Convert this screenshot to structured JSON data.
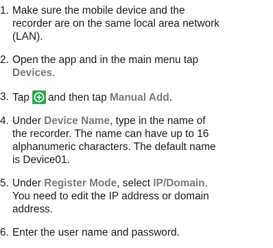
{
  "steps": [
    {
      "number": "1.",
      "lines": [
        "Make sure the mobile device and the",
        "recorder are on the same local area network",
        "(LAN)."
      ]
    },
    {
      "number": "2.",
      "line1": "Open the app and in the main menu tap",
      "highlight": "Devices",
      "suffix": "."
    },
    {
      "number": "3.",
      "before_icon": "Tap",
      "after_icon": "and then tap",
      "highlight": "Manual Add",
      "suffix": ".",
      "icon": "add-device-icon"
    },
    {
      "number": "4.",
      "prefix": "Under",
      "highlight": "Device Name",
      "line1_rest": ", type in the name of",
      "lines": [
        "the recorder. The name can have up to 16",
        "alphanumeric characters. The default name",
        "is Device01."
      ]
    },
    {
      "number": "5.",
      "prefix": "Under",
      "highlight1": "Register Mode",
      "middle": ", select",
      "highlight2": "IP/Domain",
      "suffix": ".",
      "lines": [
        "You need to edit the IP address or domain",
        "address."
      ]
    },
    {
      "number": "6.",
      "text": "Enter the user name and password."
    }
  ],
  "colors": {
    "text": "#1a1a1a",
    "highlight": "#7a7a7a",
    "icon_fill": "#2fa84f"
  }
}
